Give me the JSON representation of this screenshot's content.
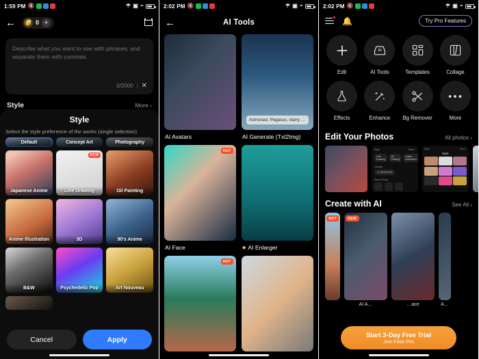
{
  "panel1": {
    "status": {
      "time": "1:59 PM",
      "icons": [
        "mute-icon",
        "green-app-icon",
        "blue-app-icon",
        "red-app-icon"
      ],
      "right_icons": [
        "bluetooth-icon",
        "sd-card-icon",
        "wifi-icon",
        "battery-icon"
      ]
    },
    "nav": {
      "back": "←",
      "credits": "0",
      "plus": "+",
      "history_icon": "history-icon"
    },
    "prompt": {
      "placeholder": "Describe what you want to see with phrases, and separate them with commas.",
      "counter": "0/2000",
      "clear": "✕"
    },
    "style_row": {
      "label": "Style",
      "more": "More ›"
    },
    "sheet": {
      "title": "Style",
      "subtitle": "Select the style preference of the works (single selection)",
      "tiles": [
        {
          "label": "Default",
          "selected": true,
          "badge": ""
        },
        {
          "label": "Concept Art",
          "selected": false,
          "badge": ""
        },
        {
          "label": "Photography",
          "selected": false,
          "badge": ""
        },
        {
          "label": "Japanese Anime",
          "selected": false,
          "badge": ""
        },
        {
          "label": "Line Drawing",
          "selected": false,
          "badge": "NEW"
        },
        {
          "label": "Oil Painting",
          "selected": false,
          "badge": ""
        },
        {
          "label": "Anime Illustration",
          "selected": false,
          "badge": ""
        },
        {
          "label": "3D",
          "selected": false,
          "badge": ""
        },
        {
          "label": "90's Anime",
          "selected": false,
          "badge": ""
        },
        {
          "label": "B&W",
          "selected": false,
          "badge": ""
        },
        {
          "label": "Psychedelic Pop",
          "selected": false,
          "badge": ""
        },
        {
          "label": "Art Nouveau",
          "selected": false,
          "badge": ""
        }
      ],
      "cancel": "Cancel",
      "apply": "Apply"
    }
  },
  "panel2": {
    "status": {
      "time": "2:02 PM"
    },
    "nav": {
      "back": "←",
      "title": "AI Tools"
    },
    "tools": [
      {
        "label": "AI Avatars",
        "badge": "",
        "pro": false,
        "chip": ""
      },
      {
        "label": "AI Generate (Txt2Img)",
        "badge": "",
        "pro": false,
        "chip": "Astronaut, Pegasus, starry …"
      },
      {
        "label": "AI Face",
        "badge": "HOT",
        "pro": false,
        "chip": ""
      },
      {
        "label": "AI Enlarger",
        "badge": "",
        "pro": true,
        "chip": ""
      },
      {
        "label": "",
        "badge": "HOT",
        "pro": false,
        "chip": ""
      },
      {
        "label": "",
        "badge": "",
        "pro": false,
        "chip": ""
      }
    ]
  },
  "panel3": {
    "status": {
      "time": "2:02 PM"
    },
    "top": {
      "menu_icon": "hamburger-menu-icon",
      "bell_icon": "notification-bell-icon",
      "pro_button": "Try Pro Features"
    },
    "functions": [
      {
        "label": "Edit",
        "icon": "plus-icon"
      },
      {
        "label": "AI Tools",
        "icon": "ai-tools-icon"
      },
      {
        "label": "Templates",
        "icon": "templates-icon"
      },
      {
        "label": "Collage",
        "icon": "collage-icon"
      },
      {
        "label": "Effects",
        "icon": "flask-effects-icon"
      },
      {
        "label": "Enhance",
        "icon": "magic-wand-icon"
      },
      {
        "label": "Bg Remover",
        "icon": "scissors-icon"
      },
      {
        "label": "More",
        "icon": "more-dots-icon"
      }
    ],
    "edit_section": {
      "title": "Edit Your Photos",
      "link": "All photos ›"
    },
    "create_section": {
      "title": "Create with AI",
      "link": "See All ›"
    },
    "create_cards": [
      {
        "label": "",
        "badge": "HOT"
      },
      {
        "label": "AI A…",
        "badge": "NEW"
      },
      {
        "label": "…ace",
        "badge": ""
      },
      {
        "label": "A…",
        "badge": ""
      }
    ],
    "cta": {
      "title": "Start 3-Day Free Trial",
      "subtitle": "Join Fotor Pro"
    }
  },
  "colors": {
    "accent_blue": "#2f7bfb",
    "cta_orange": "#f0902a",
    "hot_red": "#f4502b",
    "new_red": "#ff4d3d",
    "pro_purple": "#8d6fc4"
  }
}
